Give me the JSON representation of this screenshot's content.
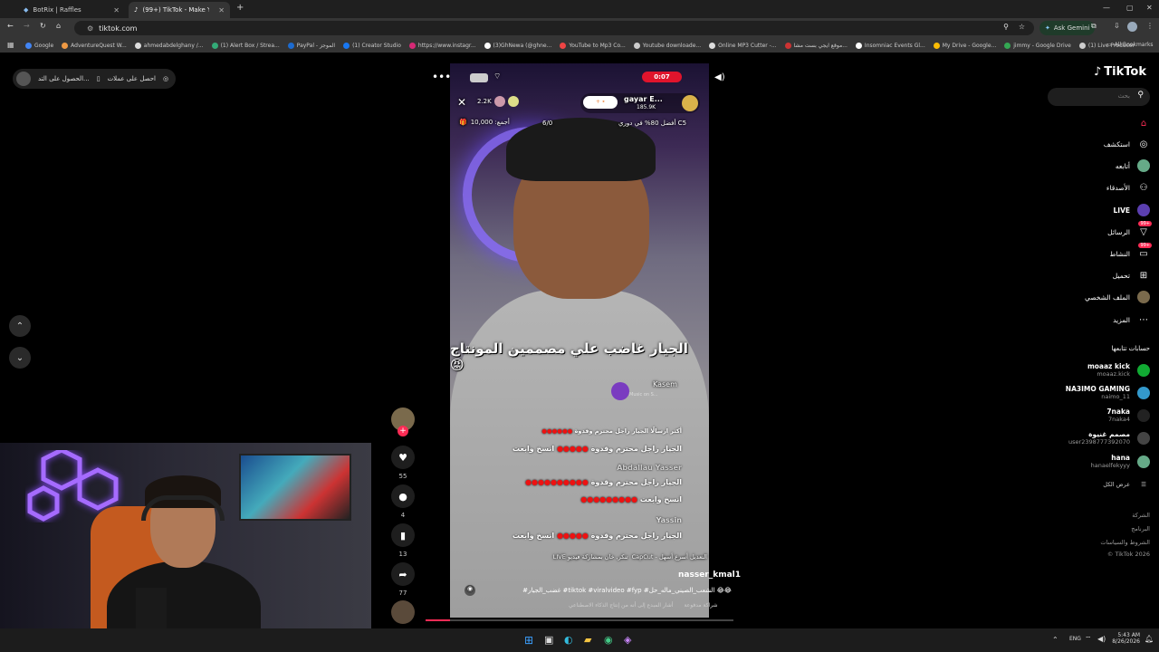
{
  "browser": {
    "tabs": [
      {
        "title": "BotRix | Raffles"
      },
      {
        "title": "(99+) TikTok - Make Your D..."
      }
    ],
    "url": "tiktok.com",
    "ask_gemini": "Ask Gemini",
    "bookmarks": [
      "Google",
      "AdventureQuest W...",
      "ahmedabdelghany /...",
      "(1) Alert Box / Strea...",
      "PayPal - الموجز",
      "(1) Creator Studio",
      "https://www.instagr...",
      "(3)GhNewa (@ghne...",
      "YouTube to Mp3 Co...",
      "Youtube downloade...",
      "Online MP3 Cutter -...",
      "موقع ايجي بست مشا...",
      "Insomniac Events Gl...",
      "My Drive - Google...",
      "jimmy - Google Drive",
      "(1) Live Producer"
    ],
    "all_bookmarks": "All Bookmarks"
  },
  "coins": {
    "label": "احصل على عملات",
    "label2": "الحصول على التد..."
  },
  "live": {
    "timer": "0:07",
    "host_name": "gayar E...",
    "host_likes": "185.9K",
    "viewers": "2.2K",
    "goal": "10,000 :أجمع",
    "progress": "6/0",
    "rank": "أفضل 80% في دوري C5",
    "caption": "الجيار غاضب علي مصممين المونتاج 😡",
    "gift_user": "Kasem",
    "gift_song": "Music on S...",
    "chat": [
      {
        "text": "أكثر ارسالًا الجيار راجل محترم وقدوة",
        "dots": "●●●●●●"
      },
      {
        "text": "انسخ وابعت",
        "dots": "●●●●●",
        "extra": "الجيار راجل محترم وقدوة"
      },
      {
        "text": "Abdallau Yasser",
        "dots": ""
      },
      {
        "text": "الجيار راجل محترم وقدوة",
        "dots": "●●●●●●●●●●"
      },
      {
        "text": "انسخ وابعت",
        "dots": "●●●●●●●●●"
      },
      {
        "text": "Yassin",
        "dots": ""
      },
      {
        "text": "انسخ وابعت",
        "dots": "●●●●●",
        "extra": "الجيار راجل محترم وقدوة"
      }
    ],
    "capcut": "CapCut - التعديل أسرع أسهل",
    "live_share": "LIVE تنكر, خان بمشاركة فيديو",
    "author": "nasser_kmal1",
    "hashtags": "#غضب_الجيار #tiktok #viralvideo #fyp #الشعب_الصيني_ماله_حل 😂😂",
    "ai_note": "أشار المبدع إلى أنه من إنتاج الذكاء الاصطناعي",
    "promo": "شراكة مدفوعة"
  },
  "actions": [
    {
      "name": "like",
      "icon": "♥",
      "count": "55"
    },
    {
      "name": "comment",
      "icon": "●",
      "count": "4"
    },
    {
      "name": "save",
      "icon": "▮",
      "count": "13"
    },
    {
      "name": "share",
      "icon": "➦",
      "count": "77"
    }
  ],
  "sidebar": {
    "brand": "TikTok",
    "search_placeholder": "بحث",
    "nav": [
      {
        "label": "",
        "icon": "⌂",
        "color": "#fe2c55"
      },
      {
        "label": "استكشف",
        "icon": "◎"
      },
      {
        "label": "أتابعه",
        "icon": "●"
      },
      {
        "label": "الأصدقاء",
        "icon": "👥"
      },
      {
        "label": "LIVE",
        "icon": "▶"
      },
      {
        "label": "الرسائل",
        "icon": "▽",
        "badge": "99+"
      },
      {
        "label": "النشاط",
        "icon": "▭",
        "badge": "99+"
      },
      {
        "label": "تحميل",
        "icon": "⊞"
      },
      {
        "label": "الملف الشخصي",
        "icon": "●"
      },
      {
        "label": "المزيد",
        "icon": "⋯"
      }
    ],
    "following_title": "حسابات تتابعها",
    "accounts": [
      {
        "name": "moaaz kick",
        "handle": "moaaz.kick",
        "color": "#1a3"
      },
      {
        "name": "NA3IMO GAMING",
        "handle": "naimo_11",
        "color": "#39c"
      },
      {
        "name": "7naka",
        "handle": "7naka4",
        "color": "#222"
      },
      {
        "name": "مصمم غنيوة",
        "handle": "user2398777392070",
        "color": "#444"
      },
      {
        "name": "hana",
        "handle": "hanaelfekyyy",
        "color": "#6a8"
      }
    ],
    "see_all": "عرض الكل",
    "footer": [
      "الشركة",
      "البرنامج",
      "الشروط والسياسات",
      "© TikTok 2026"
    ]
  },
  "taskbar": {
    "lang": "ENG",
    "time": "5:43 AM",
    "date": "8/26/2026"
  }
}
